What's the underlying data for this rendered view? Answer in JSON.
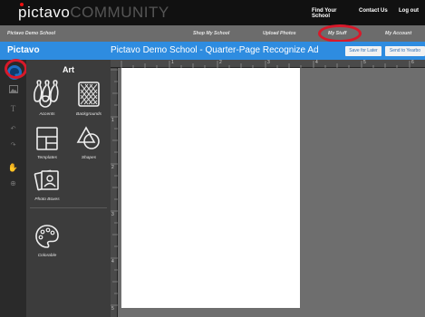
{
  "header": {
    "logo_main": "pictavo",
    "logo_sub": "COMMUNITY",
    "nav": [
      "Find Your School",
      "Contact Us",
      "Log out"
    ]
  },
  "subnav": {
    "school": "Pictavo Demo School",
    "items": [
      "Shop My School",
      "Upload Photos",
      "My Stuff",
      "My Account"
    ]
  },
  "titlebar": {
    "app_name": "Pictavo",
    "doc_title": "Pictavo Demo School - Quarter-Page  Recognize Ad",
    "save_label": "Save for Later",
    "send_label": "Send to Yearbo"
  },
  "tools": [
    "art-tool",
    "image-tool",
    "text-tool",
    "undo-tool",
    "redo-tool",
    "pan-tool",
    "zoom-tool"
  ],
  "art_panel": {
    "title": "Art",
    "tiles": [
      {
        "label": "Accents",
        "icon": "bowling-pins-icon"
      },
      {
        "label": "Backgrounds",
        "icon": "backgrounds-icon"
      },
      {
        "label": "Templates",
        "icon": "templates-icon"
      },
      {
        "label": "Shapes",
        "icon": "shapes-icon"
      },
      {
        "label": "Photo Boxes",
        "icon": "photo-boxes-icon"
      },
      {
        "label": "Colorable",
        "icon": "palette-icon"
      }
    ]
  },
  "ruler": {
    "top_labels": [
      "1",
      "2",
      "3",
      "4",
      "5",
      "6"
    ],
    "left_labels": [
      "1",
      "2",
      "3",
      "4",
      "5"
    ]
  },
  "colors": {
    "accent_blue": "#2e8ce0",
    "highlight_red": "#d7192a",
    "topbar": "#111111",
    "panel": "#3c3c3c"
  }
}
